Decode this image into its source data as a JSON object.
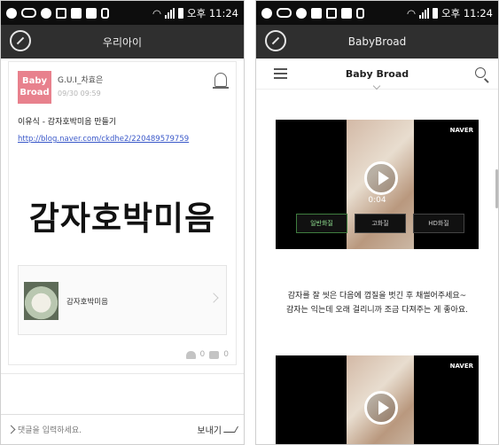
{
  "left": {
    "status": {
      "time": "오후 11:24"
    },
    "header": {
      "title": "우리아이"
    },
    "post": {
      "avatar_line1": "Baby",
      "avatar_line2": "Broad",
      "author": "G.U.I_차효은",
      "time": "09/30 09:59",
      "title": "이유식 - 감자호박미음 만들기",
      "link": "http://blog.naver.com/ckdhe2/220489579759",
      "big_text": "감자호박미음",
      "card_label": "감자호박미음",
      "likes": "0",
      "comments": "0"
    },
    "comment_bar": {
      "placeholder": "댓글을 입력하세요.",
      "send_label": "보내기"
    }
  },
  "right": {
    "status": {
      "time": "오후 11:24"
    },
    "header": {
      "title": "BabyBroad"
    },
    "blog_nav": {
      "title": "Baby Broad"
    },
    "video1": {
      "badge": "NAVER",
      "duration": "0:04",
      "qualities": [
        "일반화질",
        "고화질",
        "HD화질"
      ]
    },
    "description": {
      "line1": "감자를 잘 씻은 다음에 껍질을 벗긴 후 채썰어주세요~",
      "line2": "감자는 익는데 오래 걸리니까 조금 다져주는 게 좋아요."
    },
    "video2": {
      "badge": "NAVER"
    }
  },
  "colors": {
    "status_bar": "#0d0d0d",
    "app_header": "#2f2f2f",
    "avatar": "#e8818d",
    "link": "#3a58c9"
  }
}
